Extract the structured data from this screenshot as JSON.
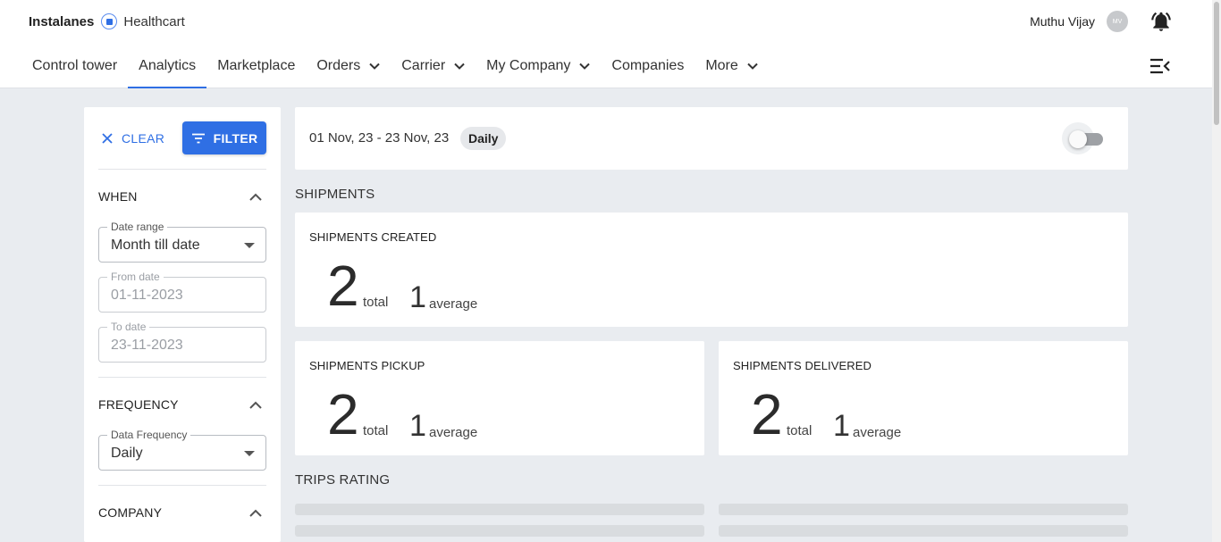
{
  "brand": {
    "name": "Instalanes",
    "org": "Healthcart"
  },
  "user": {
    "name": "Muthu Vijay",
    "initials": "MV"
  },
  "nav": [
    {
      "label": "Control tower",
      "active": false,
      "has_dropdown": false
    },
    {
      "label": "Analytics",
      "active": true,
      "has_dropdown": false
    },
    {
      "label": "Marketplace",
      "active": false,
      "has_dropdown": false
    },
    {
      "label": "Orders",
      "active": false,
      "has_dropdown": true
    },
    {
      "label": "Carrier",
      "active": false,
      "has_dropdown": true
    },
    {
      "label": "My Company",
      "active": false,
      "has_dropdown": true
    },
    {
      "label": "Companies",
      "active": false,
      "has_dropdown": false
    },
    {
      "label": "More",
      "active": false,
      "has_dropdown": true
    }
  ],
  "sidebar": {
    "clear_label": "CLEAR",
    "filter_label": "FILTER",
    "when": {
      "title": "WHEN",
      "date_range": {
        "label": "Date range",
        "value": "Month till date"
      },
      "from_date": {
        "label": "From date",
        "value": "01-11-2023"
      },
      "to_date": {
        "label": "To date",
        "value": "23-11-2023"
      }
    },
    "frequency": {
      "title": "FREQUENCY",
      "data_frequency": {
        "label": "Data Frequency",
        "value": "Daily"
      }
    },
    "company": {
      "title": "COMPANY"
    }
  },
  "summary": {
    "date_range": "01 Nov, 23 - 23 Nov, 23",
    "frequency": "Daily",
    "toggle_on": false
  },
  "shipments": {
    "section_title": "SHIPMENTS",
    "created": {
      "title": "SHIPMENTS CREATED",
      "total": "2",
      "total_label": "total",
      "average": "1",
      "average_label": "average"
    },
    "pickup": {
      "title": "SHIPMENTS PICKUP",
      "total": "2",
      "total_label": "total",
      "average": "1",
      "average_label": "average"
    },
    "delivered": {
      "title": "SHIPMENTS DELIVERED",
      "total": "2",
      "total_label": "total",
      "average": "1",
      "average_label": "average"
    }
  },
  "trips_rating": {
    "section_title": "TRIPS RATING"
  },
  "colors": {
    "accent": "#2f6fe4",
    "background": "#e9ecf0",
    "card": "#ffffff"
  }
}
